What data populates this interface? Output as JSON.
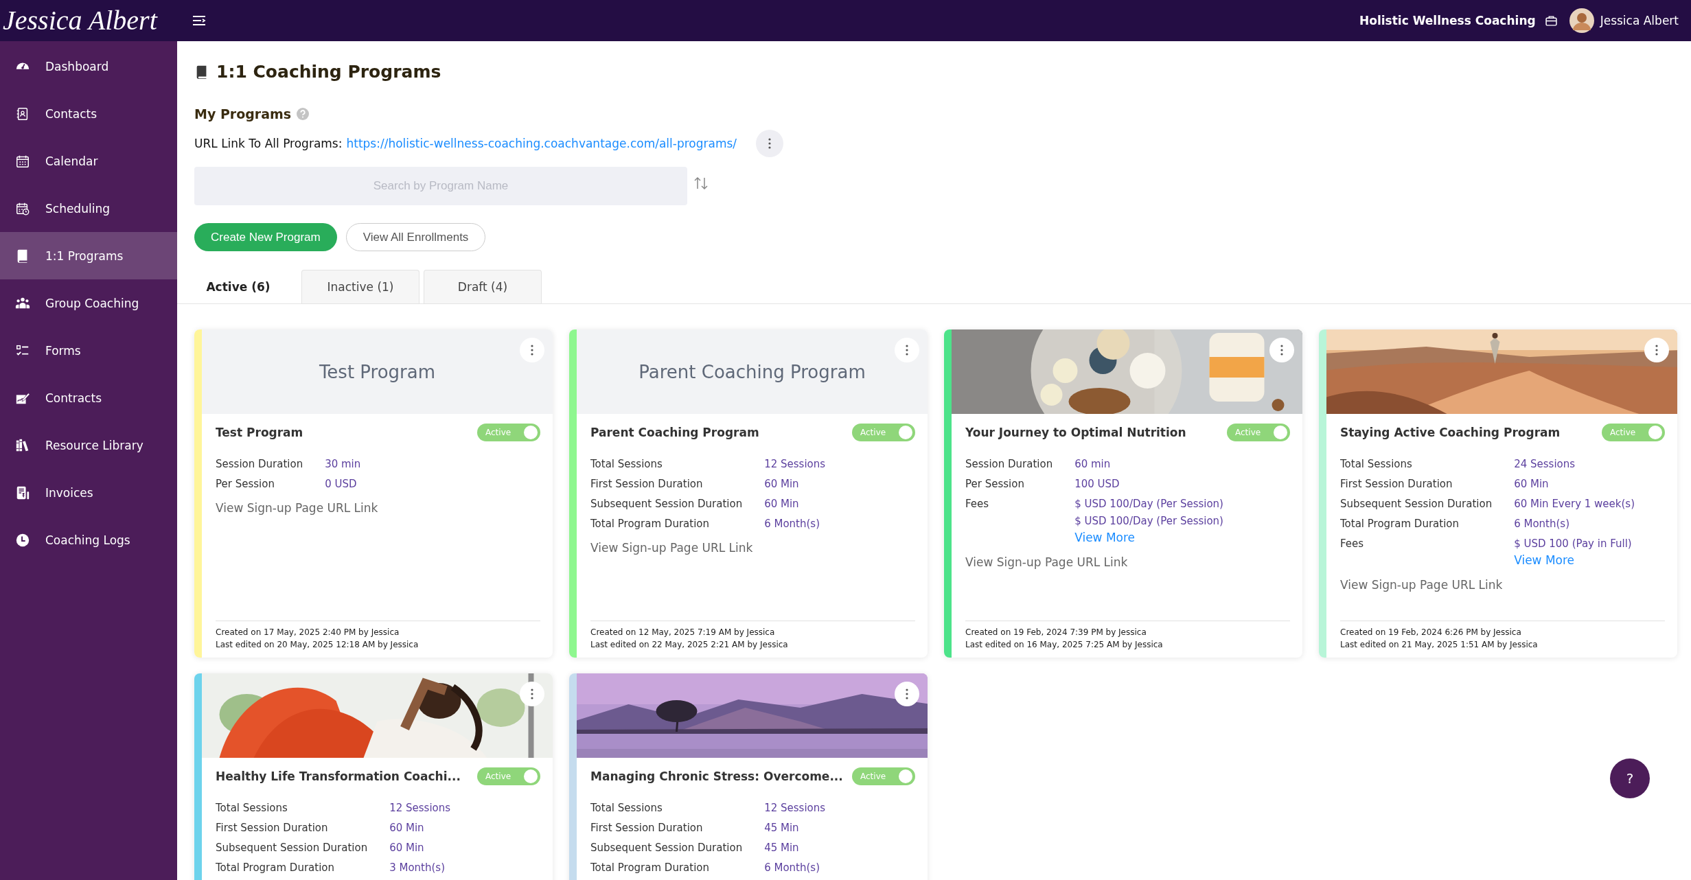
{
  "header": {
    "logo": "Jessica Albert",
    "organization": "Holistic Wellness Coaching",
    "user_name": "Jessica Albert"
  },
  "sidebar": {
    "items": [
      {
        "label": "Dashboard",
        "selected": false
      },
      {
        "label": "Contacts",
        "selected": false
      },
      {
        "label": "Calendar",
        "selected": false
      },
      {
        "label": "Scheduling",
        "selected": false
      },
      {
        "label": "1:1 Programs",
        "selected": true
      },
      {
        "label": "Group Coaching",
        "selected": false
      },
      {
        "label": "Forms",
        "selected": false
      },
      {
        "label": "Contracts",
        "selected": false
      },
      {
        "label": "Resource Library",
        "selected": false
      },
      {
        "label": "Invoices",
        "selected": false
      },
      {
        "label": "Coaching Logs",
        "selected": false
      }
    ]
  },
  "page": {
    "title": "1:1 Coaching Programs",
    "section_title": "My Programs",
    "url_label": "URL Link To All Programs:",
    "url": "https://holistic-wellness-coaching.coachvantage.com/all-programs/",
    "search": {
      "placeholder": "Search by Program Name"
    },
    "buttons": [
      {
        "label": "Create New Program",
        "kind": "primary"
      },
      {
        "label": "View All Enrollments",
        "kind": "outline"
      }
    ]
  },
  "tabs": [
    {
      "label": "Active (6)",
      "selected": true
    },
    {
      "label": "Inactive (1)",
      "selected": false
    },
    {
      "label": "Draft (4)",
      "selected": false
    }
  ],
  "cards": [
    {
      "color": "#fff59a",
      "cover": {
        "kind": "title",
        "text": "Test Program"
      },
      "title": "Test Program",
      "status": "Active",
      "active": true,
      "details": [
        {
          "label": "Session Duration",
          "values": [
            "30 min"
          ]
        },
        {
          "label": "Per Session",
          "values": [
            "0 USD"
          ]
        }
      ],
      "signup_link": "View Sign-up Page URL Link",
      "created": "Created on 17 May, 2025 2:40 PM by Jessica",
      "edited": "Last edited on 20 May, 2025 12:18 AM by Jessica"
    },
    {
      "color": "#8ef78f",
      "cover": {
        "kind": "title",
        "text": "Parent Coaching Program"
      },
      "title": "Parent Coaching Program",
      "status": "Active",
      "active": true,
      "details": [
        {
          "label": "Total Sessions",
          "values": [
            "12 Sessions"
          ]
        },
        {
          "label": "First Session Duration",
          "values": [
            "60 Min"
          ]
        },
        {
          "label": "Subsequent Session Duration",
          "values": [
            "60 Min"
          ]
        },
        {
          "label": "Total Program Duration",
          "values": [
            "6 Month(s)"
          ]
        }
      ],
      "signup_link": "View Sign-up Page URL Link",
      "created": "Created on 12 May, 2025 7:19 AM by Jessica",
      "edited": "Last edited on 22 May, 2025 2:21 AM by Jessica"
    },
    {
      "color": "#4de38a",
      "cover": {
        "kind": "picture"
      },
      "title": "Your Journey to Optimal Nutrition",
      "status": "Active",
      "active": true,
      "details": [
        {
          "label": "Session Duration",
          "values": [
            "60 min"
          ]
        },
        {
          "label": "Per Session",
          "values": [
            "100 USD"
          ]
        },
        {
          "label": "Fees",
          "values": [
            "$ USD 100/Day (Per Session)",
            "$ USD 100/Day (Per Session)"
          ]
        }
      ],
      "more_link": "View More",
      "signup_link": "View Sign-up Page URL Link",
      "created": "Created on 19 Feb, 2024 7:39 PM by Jessica",
      "edited": "Last edited on 16 May, 2025 7:25 AM by Jessica"
    },
    {
      "color": "#b8f5d8",
      "cover": {
        "kind": "picture"
      },
      "title": "Staying Active Coaching Program",
      "status": "Active",
      "active": true,
      "details": [
        {
          "label": "Total Sessions",
          "values": [
            "24 Sessions"
          ]
        },
        {
          "label": "First Session Duration",
          "values": [
            "60 Min"
          ]
        },
        {
          "label": "Subsequent Session Duration",
          "values": [
            "60 Min Every 1 week(s)"
          ]
        },
        {
          "label": "Total Program Duration",
          "values": [
            "6 Month(s)"
          ]
        },
        {
          "label": "Fees",
          "values": [
            "$ USD 100 (Pay in Full)"
          ]
        }
      ],
      "more_link": "View More",
      "signup_link": "View Sign-up Page URL Link",
      "created": "Created on 19 Feb, 2024 6:26 PM by Jessica",
      "edited": "Last edited on 21 May, 2025 1:51 AM by Jessica"
    },
    {
      "color": "#6dd3ec",
      "cover": {
        "kind": "picture"
      },
      "title": "Healthy Life Transformation Coachi...",
      "status": "Active",
      "active": true,
      "details": [
        {
          "label": "Total Sessions",
          "values": [
            "12 Sessions"
          ]
        },
        {
          "label": "First Session Duration",
          "values": [
            "60 Min"
          ]
        },
        {
          "label": "Subsequent Session Duration",
          "values": [
            "60 Min"
          ]
        },
        {
          "label": "Total Program Duration",
          "values": [
            "3 Month(s)"
          ]
        }
      ]
    },
    {
      "color": "#c5dcee",
      "cover": {
        "kind": "picture"
      },
      "title": "Managing Chronic Stress: Overcome...",
      "status": "Active",
      "active": true,
      "details": [
        {
          "label": "Total Sessions",
          "values": [
            "12 Sessions"
          ]
        },
        {
          "label": "First Session Duration",
          "values": [
            "45 Min"
          ]
        },
        {
          "label": "Subsequent Session Duration",
          "values": [
            "45 Min"
          ]
        },
        {
          "label": "Total Program Duration",
          "values": [
            "6 Month(s)"
          ]
        }
      ]
    }
  ],
  "help_button": "?"
}
